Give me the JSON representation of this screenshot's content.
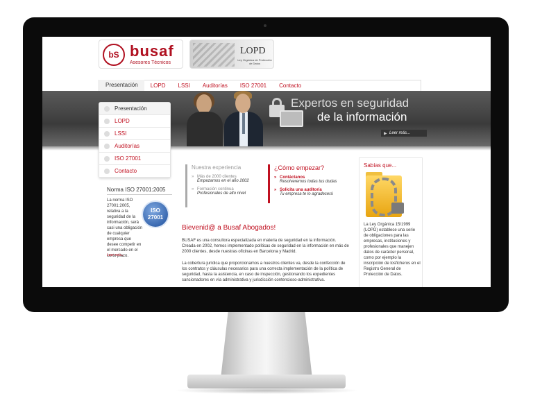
{
  "brand": {
    "name": "busaf",
    "mark": "bS",
    "subtitle": "Asesores Técnicos"
  },
  "lopd_banner": {
    "title": "LOPD",
    "subtitle": "Ley Orgánica de Protección de Datos"
  },
  "nav": {
    "items": [
      {
        "label": "Presentación",
        "active": true
      },
      {
        "label": "LOPD"
      },
      {
        "label": "LSSI"
      },
      {
        "label": "Auditorías"
      },
      {
        "label": "ISO 27001"
      },
      {
        "label": "Contacto"
      }
    ]
  },
  "hero": {
    "title_line1": "Expertos en seguridad",
    "title_line2": "de la información",
    "more_label": "Leer más..."
  },
  "sidebar": {
    "items": [
      {
        "label": "Presentación",
        "active": true
      },
      {
        "label": "LOPD"
      },
      {
        "label": "LSSI"
      },
      {
        "label": "Auditorías"
      },
      {
        "label": "ISO 27001"
      },
      {
        "label": "Contacto"
      }
    ]
  },
  "iso_box": {
    "title": "Norma ISO 27001:2005",
    "text": "La norma ISO 27001:2005, relativa a la seguridad de la información, será casi una obligación de cualquier empresa que desee competir en el mercado en el corto plazo.",
    "seal_top": "ISO",
    "seal_bottom": "27001",
    "more_label": "Leer más..."
  },
  "experience": {
    "title": "Nuestra experiencia",
    "items": [
      {
        "title": "Más de 2000 clientes",
        "sub": "Empezamos en el año 2002"
      },
      {
        "title": "Formación continua",
        "sub": "Profesionales de alto nivel"
      }
    ]
  },
  "start": {
    "title": "¿Cómo empezar?",
    "items": [
      {
        "title": "Contáctanos",
        "sub": "Resolveremos todas tus dudas"
      },
      {
        "title": "Solicita una auditoría",
        "sub": "Tu empresa te lo agradecerá"
      }
    ]
  },
  "welcome": {
    "title": "Bievenid@ a Busaf Abogados!",
    "p1": "BUSAF es una consultora especializada en materia de seguridad en la información. Creada en 2002, hemos implementado políticas de seguridad en la información en más de 2000 clientes, desde nuestras oficinas en Barcelona y Madrid.",
    "p2": "La cobertura jurídica que proporcionamos a nuestros clientes va, desde la confección de los contratos y cláusulas necesarios para una correcta implementación de la política de seguridad, hasta la asistencia, en caso de inspección, gestionando los expedientes sancionadores en vía administrativa y jurisdicción contencioso-administrativa."
  },
  "sabias": {
    "title": "Sabías que...",
    "text": "La Ley Orgánica 15/1999 (LOPD) establece una serie de obligaciones para las empresas, instituciones y profesionales que manejen datos de carácter personal, como por ejemplo la inscripción de losficheros en el Registro General de Protección de Datos."
  }
}
